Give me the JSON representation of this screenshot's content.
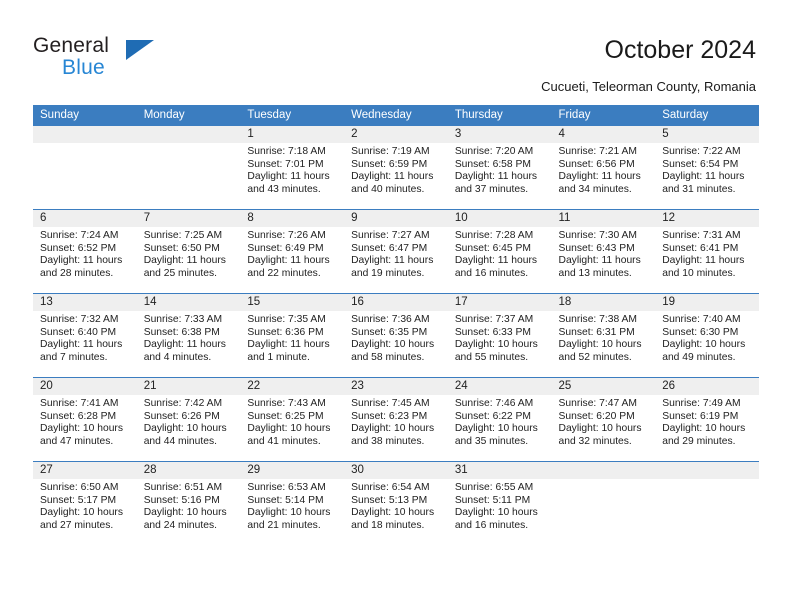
{
  "brand": {
    "line1": "General",
    "line2": "Blue",
    "triangle_color": "#1f6cb4",
    "blue_color": "#2786d4"
  },
  "header": {
    "title": "October 2024",
    "subtitle": "Cucueti, Teleorman County, Romania",
    "header_bg": "#3b7dc0",
    "band_bg": "#efefef"
  },
  "weekdays": [
    "Sunday",
    "Monday",
    "Tuesday",
    "Wednesday",
    "Thursday",
    "Friday",
    "Saturday"
  ],
  "labels": {
    "sunrise": "Sunrise:",
    "sunset": "Sunset:",
    "daylight": "Daylight:"
  },
  "weeks": [
    [
      {
        "day": "",
        "sunrise": "",
        "sunset": "",
        "daylight1": "",
        "daylight2": ""
      },
      {
        "day": "",
        "sunrise": "",
        "sunset": "",
        "daylight1": "",
        "daylight2": ""
      },
      {
        "day": "1",
        "sunrise": "Sunrise: 7:18 AM",
        "sunset": "Sunset: 7:01 PM",
        "daylight1": "Daylight: 11 hours",
        "daylight2": "and 43 minutes."
      },
      {
        "day": "2",
        "sunrise": "Sunrise: 7:19 AM",
        "sunset": "Sunset: 6:59 PM",
        "daylight1": "Daylight: 11 hours",
        "daylight2": "and 40 minutes."
      },
      {
        "day": "3",
        "sunrise": "Sunrise: 7:20 AM",
        "sunset": "Sunset: 6:58 PM",
        "daylight1": "Daylight: 11 hours",
        "daylight2": "and 37 minutes."
      },
      {
        "day": "4",
        "sunrise": "Sunrise: 7:21 AM",
        "sunset": "Sunset: 6:56 PM",
        "daylight1": "Daylight: 11 hours",
        "daylight2": "and 34 minutes."
      },
      {
        "day": "5",
        "sunrise": "Sunrise: 7:22 AM",
        "sunset": "Sunset: 6:54 PM",
        "daylight1": "Daylight: 11 hours",
        "daylight2": "and 31 minutes."
      }
    ],
    [
      {
        "day": "6",
        "sunrise": "Sunrise: 7:24 AM",
        "sunset": "Sunset: 6:52 PM",
        "daylight1": "Daylight: 11 hours",
        "daylight2": "and 28 minutes."
      },
      {
        "day": "7",
        "sunrise": "Sunrise: 7:25 AM",
        "sunset": "Sunset: 6:50 PM",
        "daylight1": "Daylight: 11 hours",
        "daylight2": "and 25 minutes."
      },
      {
        "day": "8",
        "sunrise": "Sunrise: 7:26 AM",
        "sunset": "Sunset: 6:49 PM",
        "daylight1": "Daylight: 11 hours",
        "daylight2": "and 22 minutes."
      },
      {
        "day": "9",
        "sunrise": "Sunrise: 7:27 AM",
        "sunset": "Sunset: 6:47 PM",
        "daylight1": "Daylight: 11 hours",
        "daylight2": "and 19 minutes."
      },
      {
        "day": "10",
        "sunrise": "Sunrise: 7:28 AM",
        "sunset": "Sunset: 6:45 PM",
        "daylight1": "Daylight: 11 hours",
        "daylight2": "and 16 minutes."
      },
      {
        "day": "11",
        "sunrise": "Sunrise: 7:30 AM",
        "sunset": "Sunset: 6:43 PM",
        "daylight1": "Daylight: 11 hours",
        "daylight2": "and 13 minutes."
      },
      {
        "day": "12",
        "sunrise": "Sunrise: 7:31 AM",
        "sunset": "Sunset: 6:41 PM",
        "daylight1": "Daylight: 11 hours",
        "daylight2": "and 10 minutes."
      }
    ],
    [
      {
        "day": "13",
        "sunrise": "Sunrise: 7:32 AM",
        "sunset": "Sunset: 6:40 PM",
        "daylight1": "Daylight: 11 hours",
        "daylight2": "and 7 minutes."
      },
      {
        "day": "14",
        "sunrise": "Sunrise: 7:33 AM",
        "sunset": "Sunset: 6:38 PM",
        "daylight1": "Daylight: 11 hours",
        "daylight2": "and 4 minutes."
      },
      {
        "day": "15",
        "sunrise": "Sunrise: 7:35 AM",
        "sunset": "Sunset: 6:36 PM",
        "daylight1": "Daylight: 11 hours",
        "daylight2": "and 1 minute."
      },
      {
        "day": "16",
        "sunrise": "Sunrise: 7:36 AM",
        "sunset": "Sunset: 6:35 PM",
        "daylight1": "Daylight: 10 hours",
        "daylight2": "and 58 minutes."
      },
      {
        "day": "17",
        "sunrise": "Sunrise: 7:37 AM",
        "sunset": "Sunset: 6:33 PM",
        "daylight1": "Daylight: 10 hours",
        "daylight2": "and 55 minutes."
      },
      {
        "day": "18",
        "sunrise": "Sunrise: 7:38 AM",
        "sunset": "Sunset: 6:31 PM",
        "daylight1": "Daylight: 10 hours",
        "daylight2": "and 52 minutes."
      },
      {
        "day": "19",
        "sunrise": "Sunrise: 7:40 AM",
        "sunset": "Sunset: 6:30 PM",
        "daylight1": "Daylight: 10 hours",
        "daylight2": "and 49 minutes."
      }
    ],
    [
      {
        "day": "20",
        "sunrise": "Sunrise: 7:41 AM",
        "sunset": "Sunset: 6:28 PM",
        "daylight1": "Daylight: 10 hours",
        "daylight2": "and 47 minutes."
      },
      {
        "day": "21",
        "sunrise": "Sunrise: 7:42 AM",
        "sunset": "Sunset: 6:26 PM",
        "daylight1": "Daylight: 10 hours",
        "daylight2": "and 44 minutes."
      },
      {
        "day": "22",
        "sunrise": "Sunrise: 7:43 AM",
        "sunset": "Sunset: 6:25 PM",
        "daylight1": "Daylight: 10 hours",
        "daylight2": "and 41 minutes."
      },
      {
        "day": "23",
        "sunrise": "Sunrise: 7:45 AM",
        "sunset": "Sunset: 6:23 PM",
        "daylight1": "Daylight: 10 hours",
        "daylight2": "and 38 minutes."
      },
      {
        "day": "24",
        "sunrise": "Sunrise: 7:46 AM",
        "sunset": "Sunset: 6:22 PM",
        "daylight1": "Daylight: 10 hours",
        "daylight2": "and 35 minutes."
      },
      {
        "day": "25",
        "sunrise": "Sunrise: 7:47 AM",
        "sunset": "Sunset: 6:20 PM",
        "daylight1": "Daylight: 10 hours",
        "daylight2": "and 32 minutes."
      },
      {
        "day": "26",
        "sunrise": "Sunrise: 7:49 AM",
        "sunset": "Sunset: 6:19 PM",
        "daylight1": "Daylight: 10 hours",
        "daylight2": "and 29 minutes."
      }
    ],
    [
      {
        "day": "27",
        "sunrise": "Sunrise: 6:50 AM",
        "sunset": "Sunset: 5:17 PM",
        "daylight1": "Daylight: 10 hours",
        "daylight2": "and 27 minutes."
      },
      {
        "day": "28",
        "sunrise": "Sunrise: 6:51 AM",
        "sunset": "Sunset: 5:16 PM",
        "daylight1": "Daylight: 10 hours",
        "daylight2": "and 24 minutes."
      },
      {
        "day": "29",
        "sunrise": "Sunrise: 6:53 AM",
        "sunset": "Sunset: 5:14 PM",
        "daylight1": "Daylight: 10 hours",
        "daylight2": "and 21 minutes."
      },
      {
        "day": "30",
        "sunrise": "Sunrise: 6:54 AM",
        "sunset": "Sunset: 5:13 PM",
        "daylight1": "Daylight: 10 hours",
        "daylight2": "and 18 minutes."
      },
      {
        "day": "31",
        "sunrise": "Sunrise: 6:55 AM",
        "sunset": "Sunset: 5:11 PM",
        "daylight1": "Daylight: 10 hours",
        "daylight2": "and 16 minutes."
      },
      {
        "day": "",
        "sunrise": "",
        "sunset": "",
        "daylight1": "",
        "daylight2": ""
      },
      {
        "day": "",
        "sunrise": "",
        "sunset": "",
        "daylight1": "",
        "daylight2": ""
      }
    ]
  ]
}
